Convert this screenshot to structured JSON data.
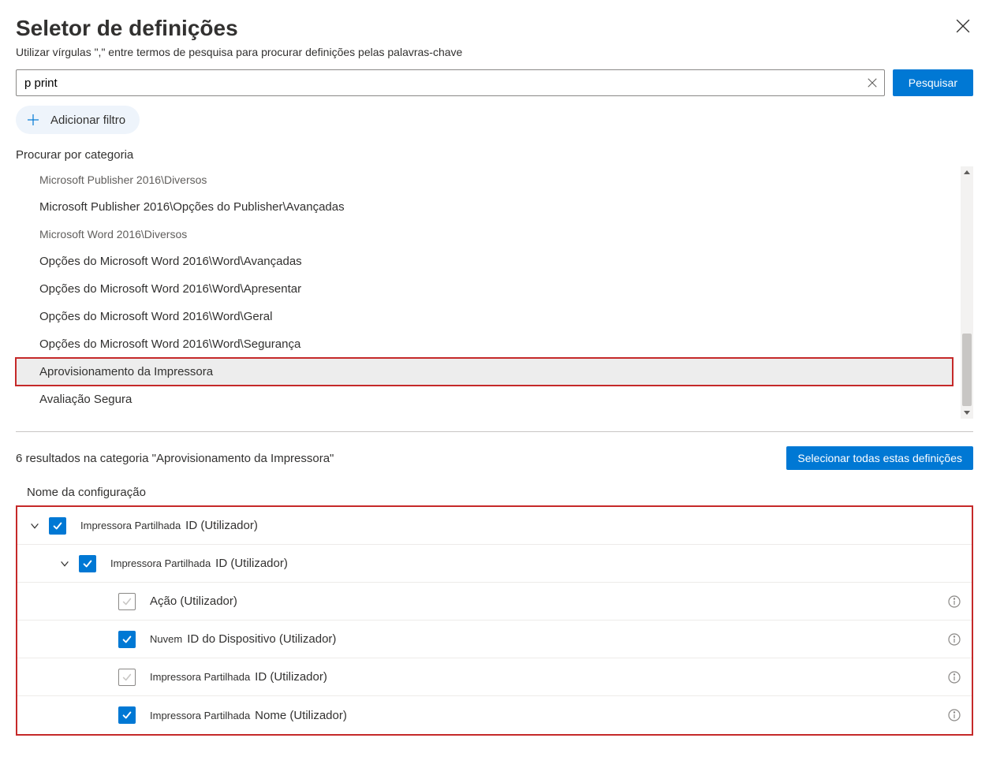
{
  "header": {
    "title": "Seletor de definições",
    "subtitle": "Utilizar vírgulas \",\" entre termos de pesquisa para procurar definições pelas palavras-chave"
  },
  "search": {
    "value": "p print",
    "button": "Pesquisar"
  },
  "filter": {
    "add": "Adicionar filtro"
  },
  "category": {
    "label": "Procurar por categoria",
    "items": [
      {
        "text": "Microsoft Publisher 2016\\Diversos",
        "muted": true,
        "selected": false
      },
      {
        "text": "Microsoft Publisher 2016\\Opções do Publisher\\Avançadas",
        "muted": false,
        "selected": false
      },
      {
        "text": "Microsoft Word 2016\\Diversos",
        "muted": true,
        "selected": false
      },
      {
        "text": "Opções do Microsoft Word 2016\\Word\\Avançadas",
        "muted": false,
        "selected": false
      },
      {
        "text": "Opções do Microsoft Word 2016\\Word\\Apresentar",
        "muted": false,
        "selected": false
      },
      {
        "text": "Opções do Microsoft Word 2016\\Word\\Geral",
        "muted": false,
        "selected": false
      },
      {
        "text": "Opções do Microsoft Word 2016\\Word\\Segurança",
        "muted": false,
        "selected": false
      },
      {
        "text": "Aprovisionamento da Impressora",
        "muted": false,
        "selected": true
      },
      {
        "text": "Avaliação Segura",
        "muted": false,
        "selected": false
      }
    ]
  },
  "results": {
    "count": "6",
    "text": "resultados na categoria \"Aprovisionamento da Impressora\"",
    "selectAll": "Selecionar todas estas definições"
  },
  "config": {
    "header": "Nome da configuração",
    "rows": [
      {
        "level": 1,
        "chevron": true,
        "checked": true,
        "prefix": "Impressora Partilhada",
        "main": "ID (Utilizador)",
        "info": false
      },
      {
        "level": 2,
        "chevron": true,
        "checked": true,
        "prefix": "Impressora Partilhada",
        "main": "ID (Utilizador)",
        "info": false
      },
      {
        "level": 3,
        "chevron": false,
        "checked": false,
        "prefix": "",
        "main": "Ação (Utilizador)",
        "info": true
      },
      {
        "level": 3,
        "chevron": false,
        "checked": true,
        "prefix": "Nuvem",
        "main": "ID do Dispositivo (Utilizador)",
        "info": true
      },
      {
        "level": 3,
        "chevron": false,
        "checked": false,
        "prefix": "Impressora Partilhada",
        "main": "ID (Utilizador)",
        "info": true
      },
      {
        "level": 3,
        "chevron": false,
        "checked": true,
        "prefix": "Impressora Partilhada",
        "main": "Nome (Utilizador)",
        "info": true
      }
    ]
  }
}
